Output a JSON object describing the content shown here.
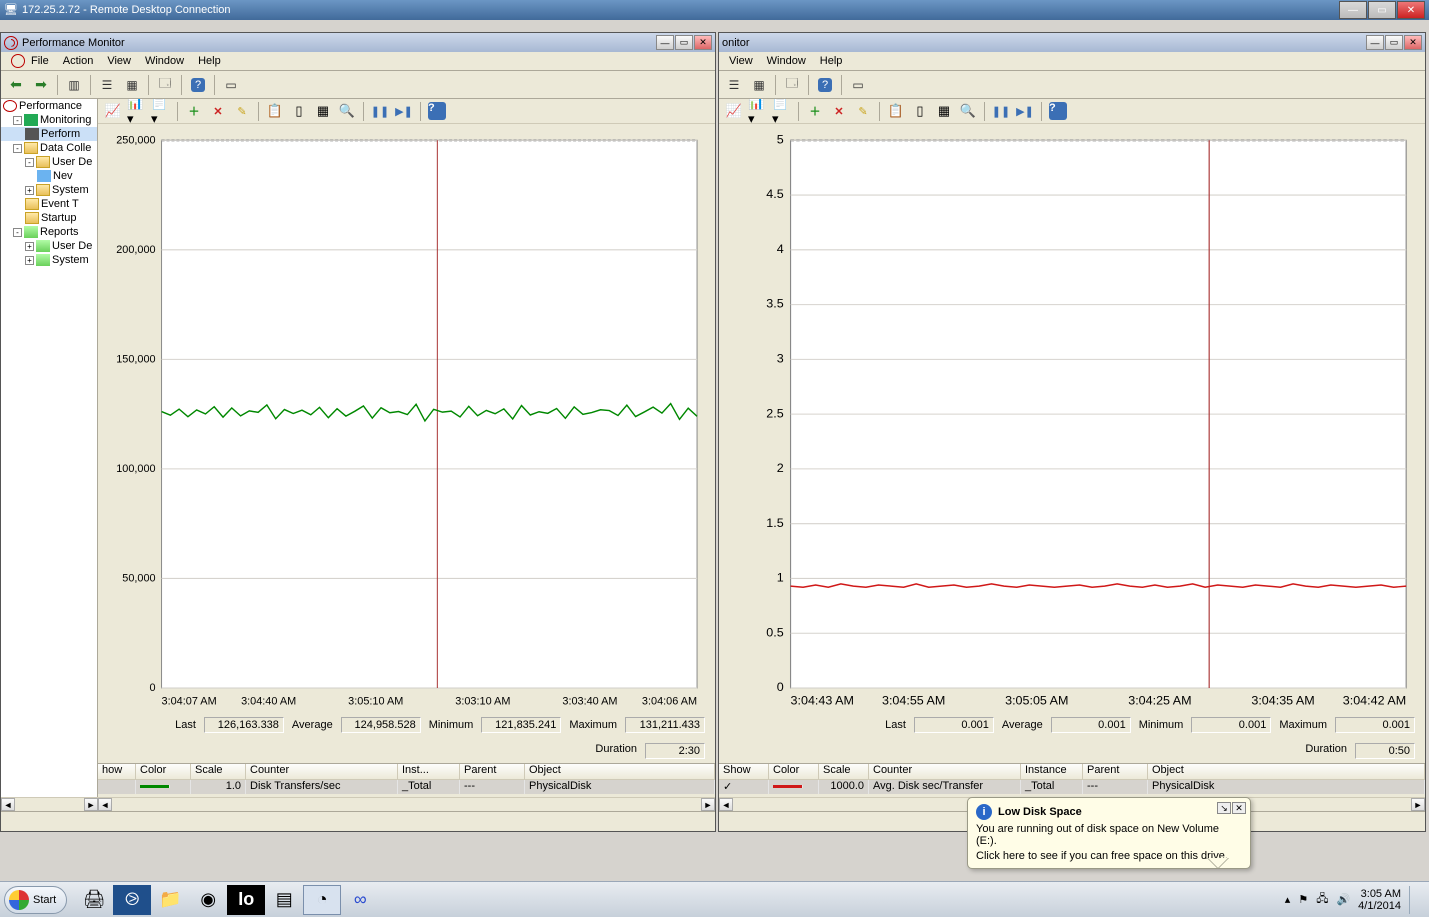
{
  "rdp": {
    "title": "172.25.2.72 - Remote Desktop Connection"
  },
  "window_left": {
    "title": "Performance Monitor",
    "menu": [
      "File",
      "Action",
      "View",
      "Window",
      "Help"
    ],
    "tree": {
      "root": "Performance",
      "items": [
        {
          "label": "Monitoring",
          "children": [
            {
              "label": "Perform",
              "selected": true
            }
          ]
        },
        {
          "label": "Data Colle",
          "children": [
            {
              "label": "User De",
              "children": [
                {
                  "label": "Nev"
                }
              ]
            },
            {
              "label": "System"
            },
            {
              "label": "Event T"
            },
            {
              "label": "Startup"
            }
          ]
        },
        {
          "label": "Reports",
          "children": [
            {
              "label": "User De"
            },
            {
              "label": "System"
            }
          ]
        }
      ]
    },
    "stats": {
      "last": "126,163.338",
      "average": "124,958.528",
      "minimum": "121,835.241",
      "maximum": "131,211.433",
      "duration": "2:30",
      "labels": {
        "last": "Last",
        "average": "Average",
        "minimum": "Minimum",
        "maximum": "Maximum",
        "duration": "Duration"
      }
    },
    "grid": {
      "headers": [
        "how",
        "Color",
        "Scale",
        "Counter",
        "Inst...",
        "Parent",
        "Object"
      ],
      "row": {
        "show": "",
        "color": "#008800",
        "scale": "1.0",
        "counter": "Disk Transfers/sec",
        "instance": "_Total",
        "parent": "---",
        "object": "PhysicalDisk"
      }
    }
  },
  "window_right": {
    "title": "onitor",
    "menu": [
      "View",
      "Window",
      "Help"
    ],
    "stats": {
      "last": "0.001",
      "average": "0.001",
      "minimum": "0.001",
      "maximum": "0.001",
      "duration": "0:50",
      "labels": {
        "last": "Last",
        "average": "Average",
        "minimum": "Minimum",
        "maximum": "Maximum",
        "duration": "Duration"
      }
    },
    "grid": {
      "headers": [
        "Show",
        "Color",
        "Scale",
        "Counter",
        "Instance",
        "Parent",
        "Object"
      ],
      "row": {
        "show": "✓",
        "color": "#d01818",
        "scale": "1000.0",
        "counter": "Avg. Disk sec/Transfer",
        "instance": "_Total",
        "parent": "---",
        "object": "PhysicalDisk"
      }
    }
  },
  "chart_data": [
    {
      "type": "line",
      "title": "",
      "ylim": [
        0,
        250000
      ],
      "yticks": [
        0,
        50000,
        100000,
        150000,
        200000,
        250000
      ],
      "xlabels": [
        "3:04:07 AM",
        "3:04:40 AM",
        "3:05:10 AM",
        "3:03:10 AM",
        "3:03:40 AM",
        "3:04:06 AM"
      ],
      "cursor_x_frac": 0.515,
      "series": [
        {
          "name": "Disk Transfers/sec",
          "color": "#008800",
          "values": [
            126200,
            124500,
            127300,
            123800,
            126900,
            125100,
            128400,
            123600,
            127800,
            124200,
            126500,
            125800,
            129200,
            122900,
            127100,
            125300,
            126800,
            124700,
            128100,
            123400,
            127500,
            124100,
            126300,
            128700,
            123200,
            127900,
            125600,
            126200,
            124800,
            129500,
            121900,
            127200,
            125900,
            126400,
            123700,
            128600,
            124300,
            126700,
            125200,
            127400,
            122800,
            128900,
            124600,
            126100,
            125400,
            127600,
            123100,
            128300,
            124900,
            125700,
            127000,
            126600,
            124400,
            129100,
            123900,
            126000,
            128200,
            125500,
            129800,
            122600,
            127700,
            124000
          ]
        }
      ]
    },
    {
      "type": "line",
      "title": "",
      "ylim": [
        0,
        5.0
      ],
      "yticks": [
        0,
        0.5,
        1.0,
        1.5,
        2.0,
        2.5,
        3.0,
        3.5,
        4.0,
        4.5,
        5.0
      ],
      "xlabels": [
        "3:04:43 AM",
        "3:04:55 AM",
        "3:05:05 AM",
        "3:04:25 AM",
        "3:04:35 AM",
        "3:04:42 AM"
      ],
      "cursor_x_frac": 0.68,
      "series": [
        {
          "name": "Avg. Disk sec/Transfer (×1000)",
          "color": "#d01818",
          "values": [
            0.93,
            0.92,
            0.94,
            0.92,
            0.95,
            0.93,
            0.92,
            0.94,
            0.93,
            0.92,
            0.95,
            0.92,
            0.93,
            0.94,
            0.92,
            0.93,
            0.95,
            0.93,
            0.92,
            0.94,
            0.93,
            0.92,
            0.93,
            0.94,
            0.92,
            0.93,
            0.95,
            0.93,
            0.92,
            0.94,
            0.92,
            0.93,
            0.95,
            0.92,
            0.94,
            0.93,
            0.92,
            0.94,
            0.93,
            0.92,
            0.95,
            0.93,
            0.92,
            0.94,
            0.93,
            0.92,
            0.93,
            0.94,
            0.92,
            0.93
          ]
        }
      ]
    }
  ],
  "balloon": {
    "title": "Low Disk Space",
    "line1": "You are running out of disk space on New Volume (E:).",
    "line2": "Click here to see if you can free space on this drive."
  },
  "taskbar": {
    "start": "Start",
    "time": "3:05 AM",
    "date": "4/1/2014"
  }
}
